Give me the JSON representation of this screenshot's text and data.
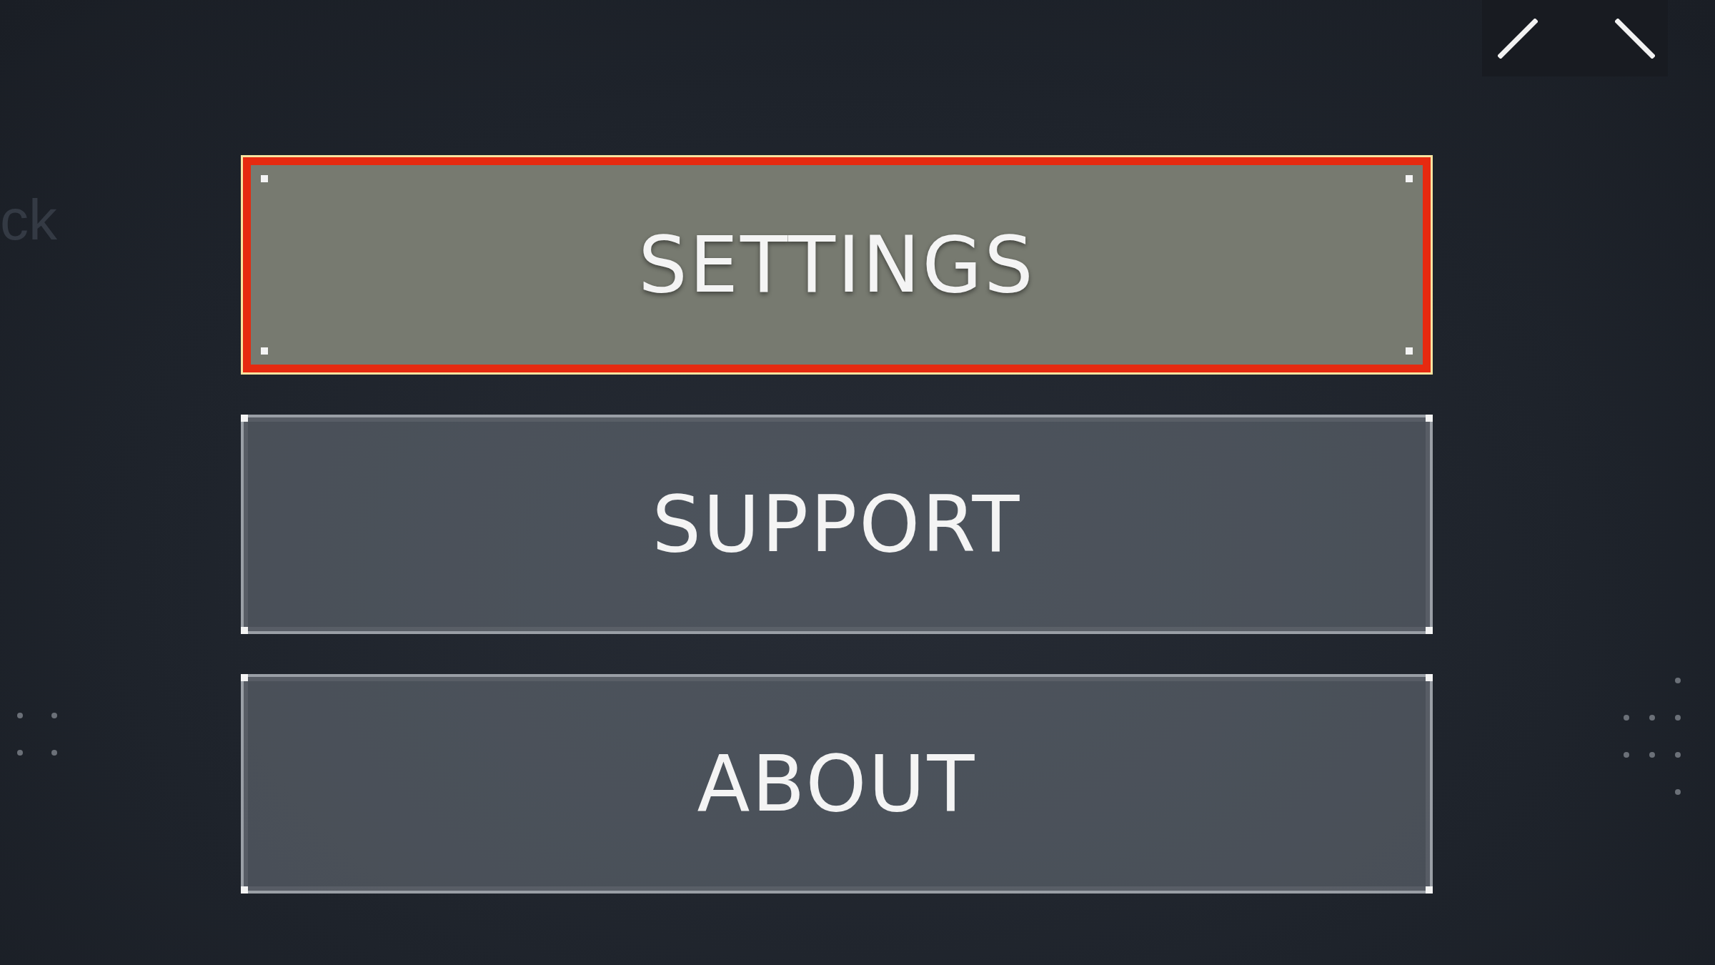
{
  "background_text": "ck",
  "menu": [
    {
      "label": "SETTINGS",
      "selected": true
    },
    {
      "label": "SUPPORT",
      "selected": false
    },
    {
      "label": "ABOUT",
      "selected": false
    }
  ]
}
